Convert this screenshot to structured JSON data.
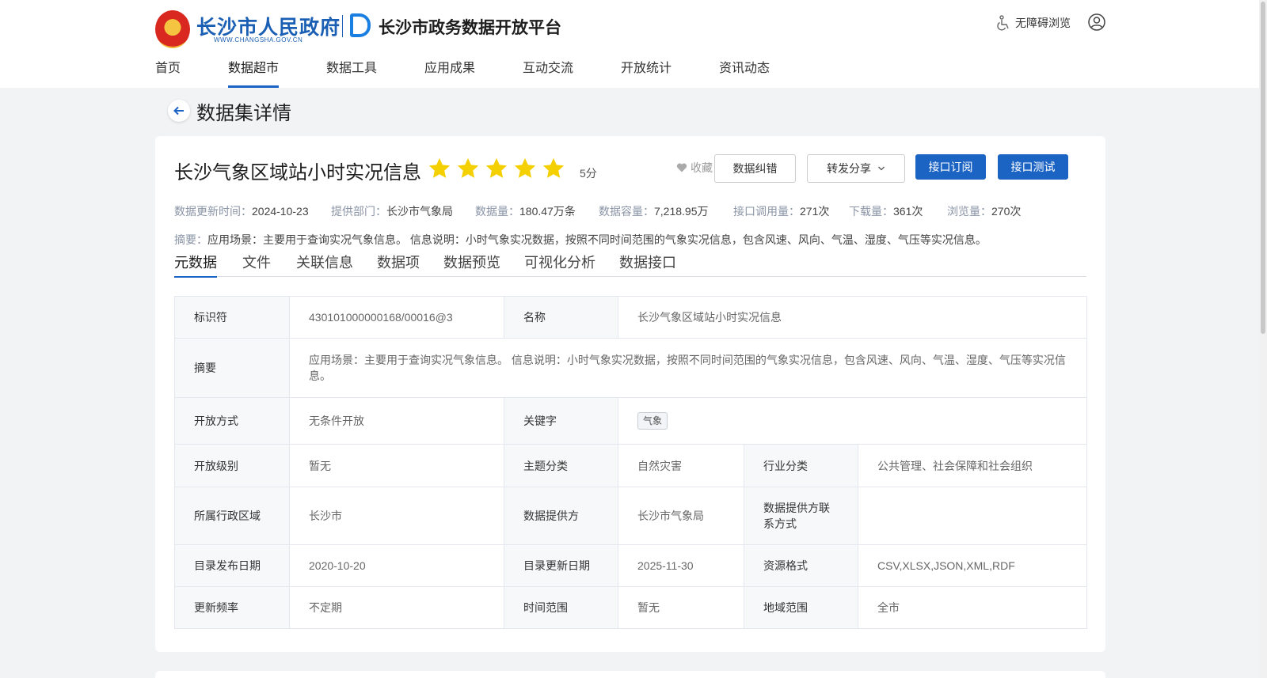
{
  "header": {
    "gov_name": "长沙市人民政府",
    "gov_url": "WWW.CHANGSHA.GOV.CN",
    "platform_name": "长沙市政务数据开放平台",
    "accessibility_label": "无障碍浏览"
  },
  "nav": [
    {
      "label": "首页"
    },
    {
      "label": "数据超市"
    },
    {
      "label": "数据工具"
    },
    {
      "label": "应用成果"
    },
    {
      "label": "互动交流"
    },
    {
      "label": "开放统计"
    },
    {
      "label": "资讯动态"
    }
  ],
  "page": {
    "title": "数据集详情"
  },
  "dataset": {
    "title": "长沙气象区域站小时实况信息",
    "rating": 5,
    "score_label": "5分",
    "favorite_label": "收藏",
    "buttons": {
      "correct": "数据纠错",
      "share": "转发分享",
      "subscribe": "接口订阅",
      "test": "接口测试"
    },
    "meta": {
      "update_label": "数据更新时间：",
      "update_value": "2024-10-23",
      "dept_label": "提供部门：",
      "dept_value": "长沙市气象局",
      "count_label": "数据量：",
      "count_value": "180.47万条",
      "capacity_label": "数据容量：",
      "capacity_value": "7,218.95万",
      "calls_label": "接口调用量：",
      "calls_value": "271次",
      "downloads_label": "下载量：",
      "downloads_value": "361次",
      "views_label": "浏览量：",
      "views_value": "270次"
    },
    "summary_label": "摘要：",
    "summary_value": "应用场景：主要用于查询实况气象信息。 信息说明：小时气象实况数据，按照不同时间范围的气象实况信息，包含风速、风向、气温、湿度、气压等实况信息。"
  },
  "tabs": [
    {
      "label": "元数据"
    },
    {
      "label": "文件"
    },
    {
      "label": "关联信息"
    },
    {
      "label": "数据项"
    },
    {
      "label": "数据预览"
    },
    {
      "label": "可视化分析"
    },
    {
      "label": "数据接口"
    }
  ],
  "table": {
    "identifier_k": "标识符",
    "identifier_v": "430101000000168/00016@3",
    "name_k": "名称",
    "name_v": "长沙气象区域站小时实况信息",
    "abstract_k": "摘要",
    "abstract_v": "应用场景：主要用于查询实况气象信息。 信息说明：小时气象实况数据，按照不同时间范围的气象实况信息，包含风速、风向、气温、湿度、气压等实况信息。",
    "open_mode_k": "开放方式",
    "open_mode_v": "无条件开放",
    "keyword_k": "关键字",
    "keyword_tag": "气象",
    "open_level_k": "开放级别",
    "open_level_v": "暂无",
    "topic_k": "主题分类",
    "topic_v": "自然灾害",
    "industry_k": "行业分类",
    "industry_v": "公共管理、社会保障和社会组织",
    "region_k": "所属行政区域",
    "region_v": "长沙市",
    "provider_k": "数据提供方",
    "provider_v": "长沙市气象局",
    "contact_k": "数据提供方联系方式",
    "contact_v": "",
    "publish_k": "目录发布日期",
    "publish_v": "2020-10-20",
    "updated_k": "目录更新日期",
    "updated_v": "2025-11-30",
    "format_k": "资源格式",
    "format_v": "CSV,XLSX,JSON,XML,RDF",
    "freq_k": "更新频率",
    "freq_v": "不定期",
    "time_k": "时间范围",
    "time_v": "暂无",
    "geo_k": "地域范围",
    "geo_v": "全市"
  },
  "colors": {
    "accent": "#1c64c4",
    "star": "#f5d000"
  }
}
